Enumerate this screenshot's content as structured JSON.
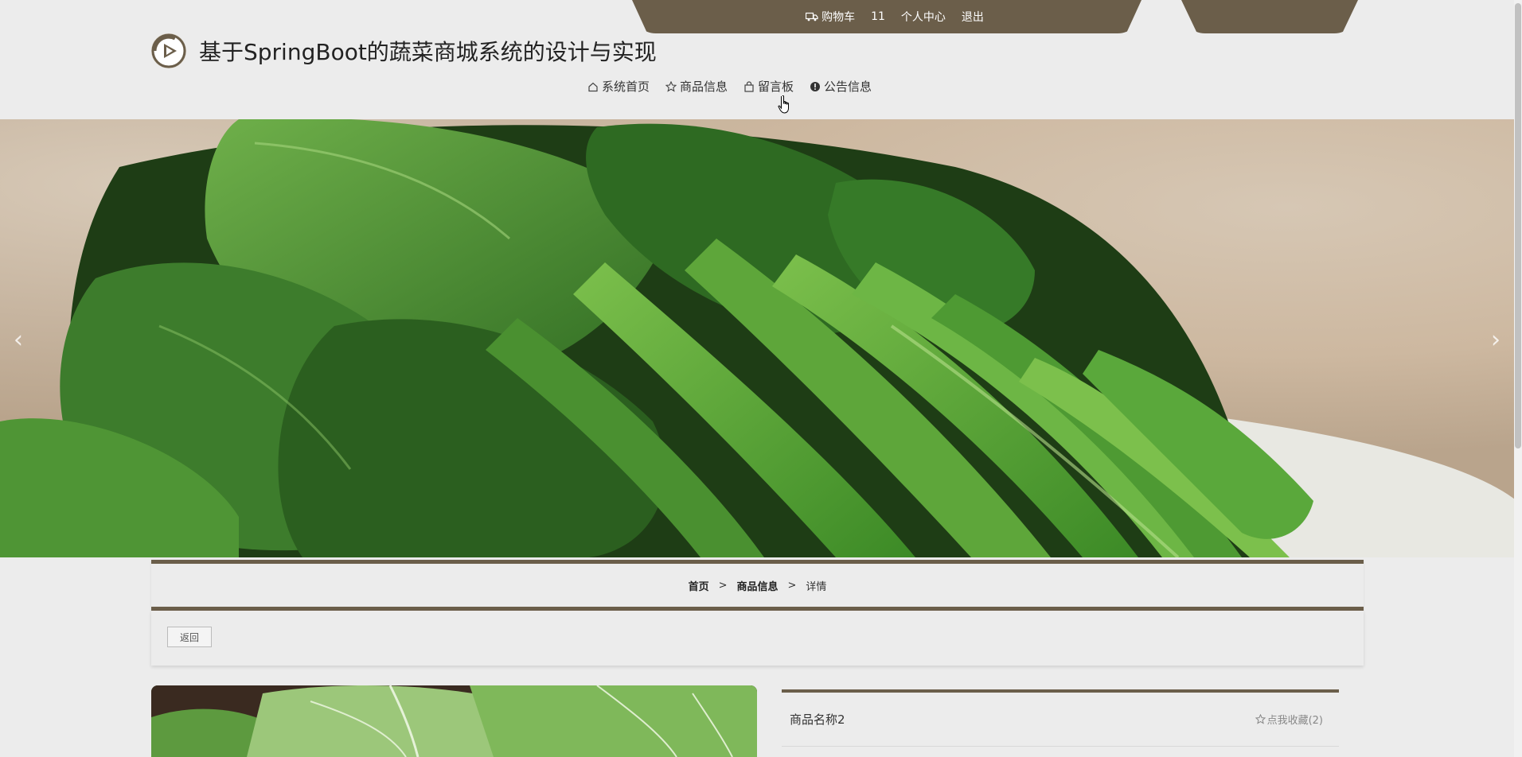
{
  "topbar": {
    "cart_label": "购物车",
    "username": "11",
    "profile_label": "个人中心",
    "logout_label": "退出"
  },
  "header": {
    "title": "基于SpringBoot的蔬菜商城系统的设计与实现"
  },
  "nav": {
    "items": [
      {
        "label": "系统首页",
        "icon": "home-icon"
      },
      {
        "label": "商品信息",
        "icon": "star-icon"
      },
      {
        "label": "留言板",
        "icon": "bag-icon"
      },
      {
        "label": "公告信息",
        "icon": "info-icon"
      }
    ]
  },
  "banner": {
    "prev_label": "‹",
    "next_label": "›"
  },
  "breadcrumb": {
    "home": "首页",
    "category": "商品信息",
    "current": "详情",
    "sep": ">"
  },
  "back": {
    "label": "返回"
  },
  "product": {
    "name": "商品名称2",
    "fav_label": "点我收藏(2)"
  },
  "colors": {
    "accent": "#6b5e4a",
    "background": "#ececec"
  }
}
